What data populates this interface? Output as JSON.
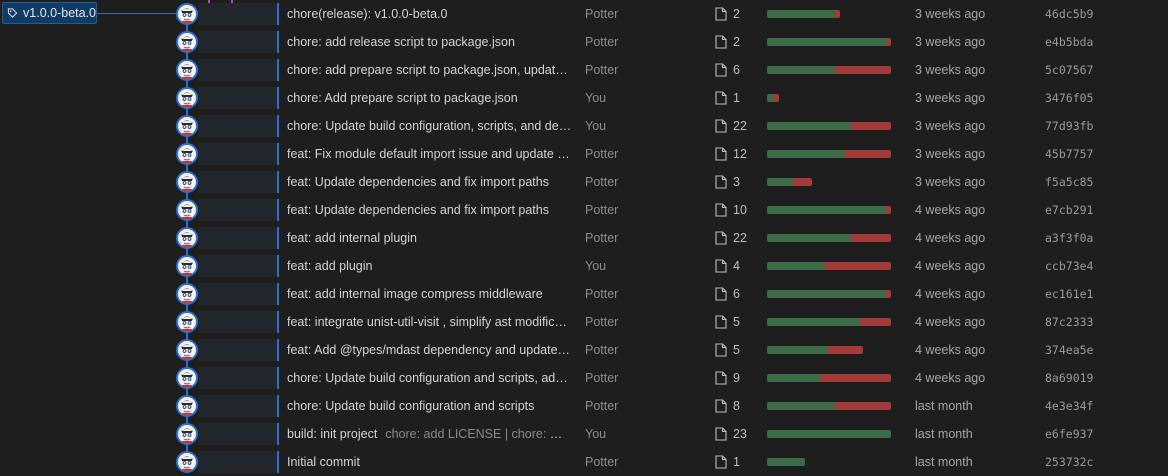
{
  "tag": {
    "label": "v1.0.0-beta.0",
    "icon": "tag-icon"
  },
  "colors": {
    "graph_line": "#2f6fd0",
    "branch_magenta": "#c13cc1",
    "additions": "#3d6b46",
    "deletions": "#a33b3b"
  },
  "commits": [
    {
      "message": "chore(release): v1.0.0-beta.0",
      "extra": "",
      "author": "Potter",
      "files": "2",
      "add_frac": 0.55,
      "del_frac": 0.04,
      "date": "3 weeks ago",
      "hash": "46dc5b9"
    },
    {
      "message": "chore: add release script to package.json",
      "extra": "",
      "author": "Potter",
      "files": "2",
      "add_frac": 0.97,
      "del_frac": 0.03,
      "date": "3 weeks ago",
      "hash": "e4b5bda"
    },
    {
      "message": "chore: add prepare script to package.json, update b...",
      "extra": "",
      "author": "Potter",
      "files": "6",
      "add_frac": 0.55,
      "del_frac": 0.45,
      "date": "3 weeks ago",
      "hash": "5c07567"
    },
    {
      "message": "chore: Add prepare script to package.json",
      "extra": "",
      "author": "You",
      "files": "1",
      "add_frac": 0.06,
      "del_frac": 0.04,
      "date": "3 weeks ago",
      "hash": "3476f05"
    },
    {
      "message": "chore: Update build configuration, scripts, and depe...",
      "extra": "",
      "author": "You",
      "files": "22",
      "add_frac": 0.68,
      "del_frac": 0.32,
      "date": "3 weeks ago",
      "hash": "77d93fb"
    },
    {
      "message": "feat: Fix module default import issue and update im...",
      "extra": "",
      "author": "Potter",
      "files": "12",
      "add_frac": 0.63,
      "del_frac": 0.37,
      "date": "3 weeks ago",
      "hash": "45b7757"
    },
    {
      "message": "feat: Update dependencies and fix import paths",
      "extra": "",
      "author": "Potter",
      "files": "3",
      "add_frac": 0.21,
      "del_frac": 0.15,
      "date": "3 weeks ago",
      "hash": "f5a5c85"
    },
    {
      "message": "feat: Update dependencies and fix import paths",
      "extra": "",
      "author": "Potter",
      "files": "10",
      "add_frac": 0.96,
      "del_frac": 0.04,
      "date": "4 weeks ago",
      "hash": "e7cb291"
    },
    {
      "message": "feat: add internal plugin",
      "extra": "",
      "author": "Potter",
      "files": "22",
      "add_frac": 0.68,
      "del_frac": 0.32,
      "date": "4 weeks ago",
      "hash": "a3f3f0a"
    },
    {
      "message": "feat: add plugin",
      "extra": "",
      "author": "You",
      "files": "4",
      "add_frac": 0.47,
      "del_frac": 0.53,
      "date": "4 weeks ago",
      "hash": "ccb73e4"
    },
    {
      "message": "feat: add internal image compress middleware",
      "extra": "",
      "author": "Potter",
      "files": "6",
      "add_frac": 0.96,
      "del_frac": 0.04,
      "date": "4 weeks ago",
      "hash": "ec161e1"
    },
    {
      "message": "feat: integrate unist-util-visit , simplify ast modificati...",
      "extra": "",
      "author": "Potter",
      "files": "5",
      "add_frac": 0.75,
      "del_frac": 0.25,
      "date": "4 weeks ago",
      "hash": "87c2333"
    },
    {
      "message": "feat: Add @types/mdast dependency and update m...",
      "extra": "",
      "author": "Potter",
      "files": "5",
      "add_frac": 0.49,
      "del_frac": 0.28,
      "date": "4 weeks ago",
      "hash": "374ea5e"
    },
    {
      "message": "chore: Update build configuration and scripts, add L...",
      "extra": "",
      "author": "Potter",
      "files": "9",
      "add_frac": 0.43,
      "del_frac": 0.57,
      "date": "4 weeks ago",
      "hash": "8a69019"
    },
    {
      "message": "chore: Update build configuration and scripts",
      "extra": "",
      "author": "Potter",
      "files": "8",
      "add_frac": 0.55,
      "del_frac": 0.45,
      "date": "last month",
      "hash": "4e3e34f"
    },
    {
      "message": "build: init project",
      "extra": "chore: add LICENSE | chore: 改成...",
      "author": "You",
      "files": "23",
      "add_frac": 1.0,
      "del_frac": 0.0,
      "date": "last month",
      "hash": "e6fe937"
    },
    {
      "message": "Initial commit",
      "extra": "",
      "author": "Potter",
      "files": "1",
      "add_frac": 0.31,
      "del_frac": 0.0,
      "date": "last month",
      "hash": "253732c"
    }
  ]
}
